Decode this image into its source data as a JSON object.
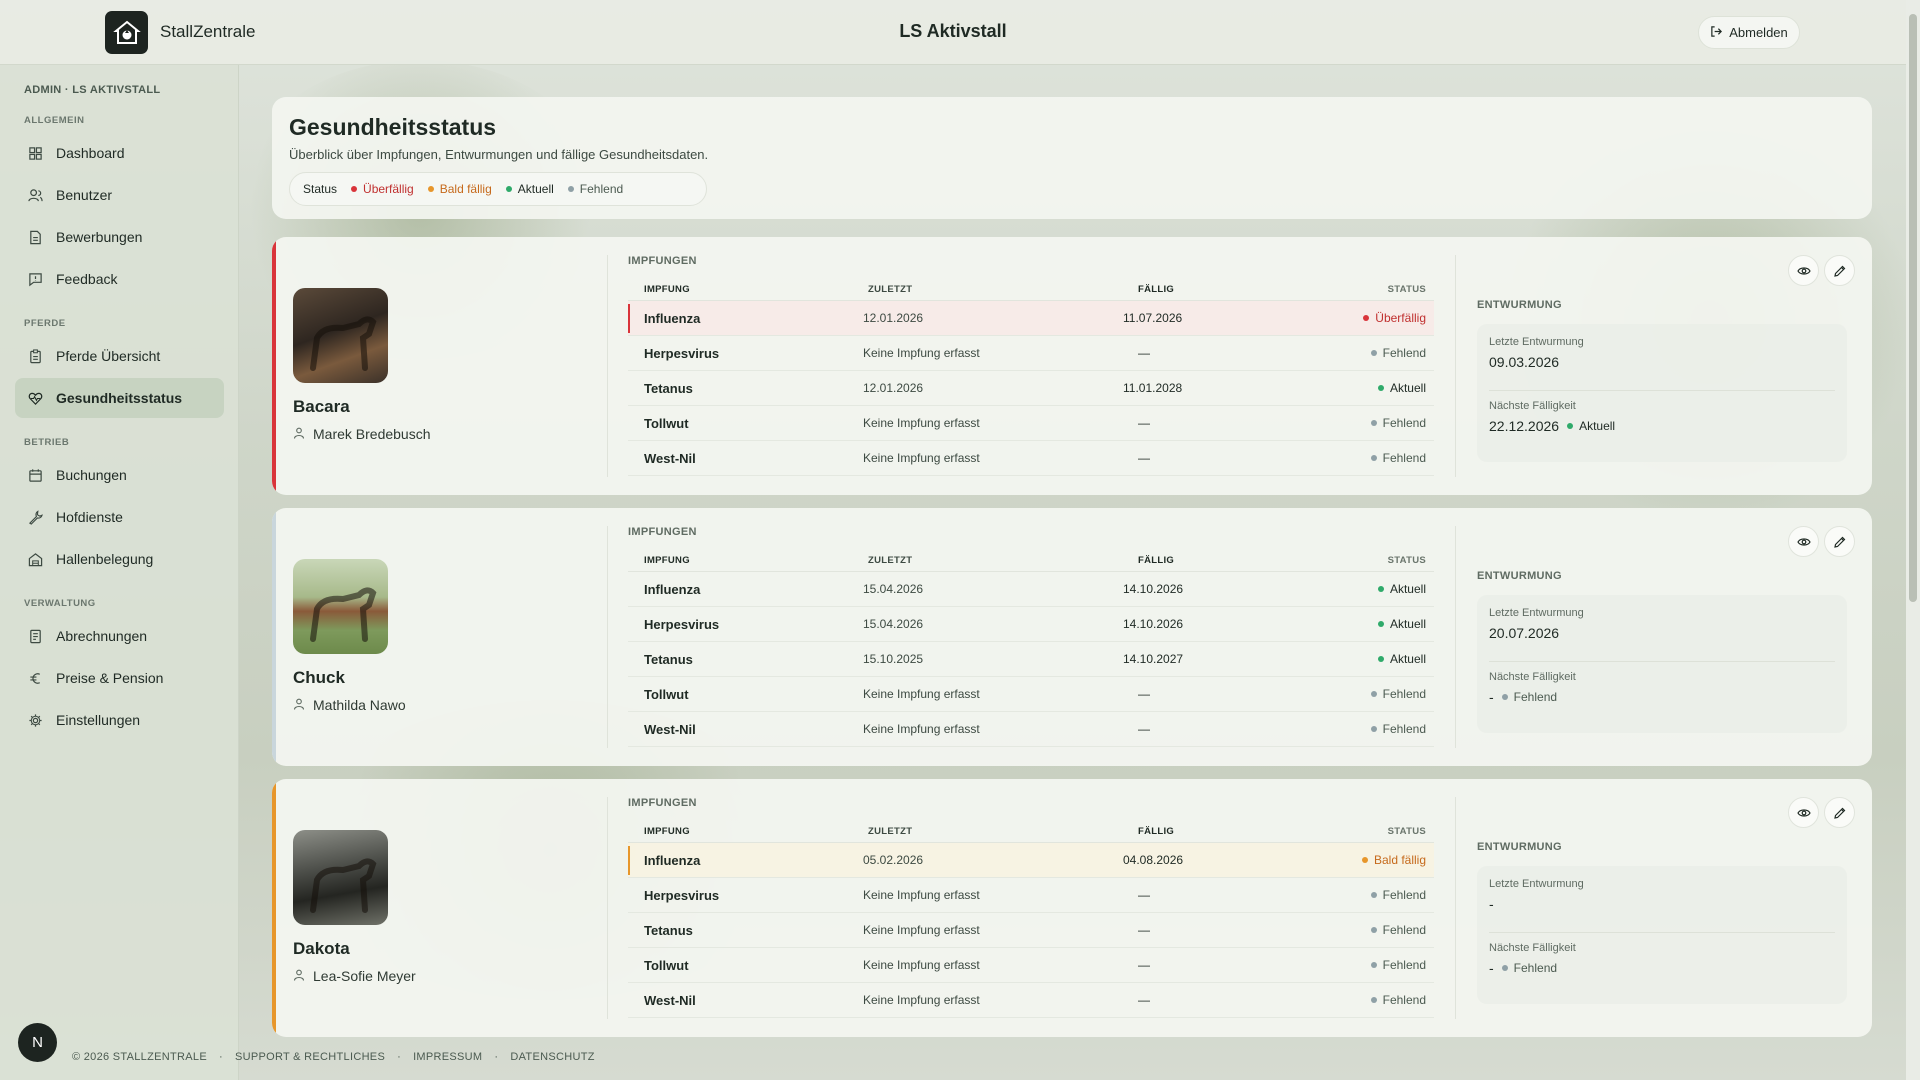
{
  "header": {
    "brand": "StallZentrale",
    "org_title": "LS Aktivstall",
    "logout_label": "Abmelden"
  },
  "sidebar": {
    "admin_label": "ADMIN · LS AKTIVSTALL",
    "sections": {
      "allgemein": "ALLGEMEIN",
      "pferde": "PFERDE",
      "betrieb": "BETRIEB",
      "verwaltung": "VERWALTUNG"
    },
    "items": {
      "dashboard": "Dashboard",
      "benutzer": "Benutzer",
      "bewerbungen": "Bewerbungen",
      "feedback": "Feedback",
      "pferde_uebersicht": "Pferde Übersicht",
      "gesundheitsstatus": "Gesundheitsstatus",
      "buchungen": "Buchungen",
      "hofdienste": "Hofdienste",
      "hallenbelegung": "Hallenbelegung",
      "abrechnungen": "Abrechnungen",
      "preise": "Preise & Pension",
      "einstellungen": "Einstellungen"
    },
    "user_initial": "N"
  },
  "overview": {
    "title": "Gesundheitsstatus",
    "subtitle": "Überblick über Impfungen, Entwurmungen und fällige Gesundheitsdaten.",
    "legend_label": "Status",
    "legend": {
      "overdue": "Überfällig",
      "soon": "Bald fällig",
      "current": "Aktuell",
      "missing": "Fehlend"
    }
  },
  "colors": {
    "overdue": "#d9343a",
    "soon": "#e7962b",
    "current": "#2faa6a",
    "missing": "#8fa0a6",
    "overdue_text": "#c0302f",
    "soon_text": "#c66a1c"
  },
  "table_headers": {
    "section": "IMPFUNGEN",
    "name": "IMPFUNG",
    "last": "ZULETZT",
    "due": "FÄLLIG",
    "status": "STATUS",
    "worm_section": "ENTWURMUNG",
    "worm_last": "Letzte Entwurmung",
    "worm_next": "Nächste Fälligkeit"
  },
  "horses": [
    {
      "name": "Bacara",
      "owner": "Marek Bredebusch",
      "vaccinations": [
        {
          "name": "Influenza",
          "last": "12.01.2026",
          "due": "11.07.2026",
          "status": "Überfällig"
        },
        {
          "name": "Herpesvirus",
          "last": "Keine Impfung erfasst",
          "due": "—",
          "status": "Fehlend"
        },
        {
          "name": "Tetanus",
          "last": "12.01.2026",
          "due": "11.01.2028",
          "status": "Aktuell"
        },
        {
          "name": "Tollwut",
          "last": "Keine Impfung erfasst",
          "due": "—",
          "status": "Fehlend"
        },
        {
          "name": "West-Nil",
          "last": "Keine Impfung erfasst",
          "due": "—",
          "status": "Fehlend"
        }
      ],
      "worming": {
        "last": "09.03.2026",
        "next": "22.12.2026",
        "next_status": "Aktuell"
      }
    },
    {
      "name": "Chuck",
      "owner": "Mathilda Nawo",
      "vaccinations": [
        {
          "name": "Influenza",
          "last": "15.04.2026",
          "due": "14.10.2026",
          "status": "Aktuell"
        },
        {
          "name": "Herpesvirus",
          "last": "15.04.2026",
          "due": "14.10.2026",
          "status": "Aktuell"
        },
        {
          "name": "Tetanus",
          "last": "15.10.2025",
          "due": "14.10.2027",
          "status": "Aktuell"
        },
        {
          "name": "Tollwut",
          "last": "Keine Impfung erfasst",
          "due": "—",
          "status": "Fehlend"
        },
        {
          "name": "West-Nil",
          "last": "Keine Impfung erfasst",
          "due": "—",
          "status": "Fehlend"
        }
      ],
      "worming": {
        "last": "20.07.2026",
        "next": "-",
        "next_status": "Fehlend"
      }
    },
    {
      "name": "Dakota",
      "owner": "Lea-Sofie Meyer",
      "vaccinations": [
        {
          "name": "Influenza",
          "last": "05.02.2026",
          "due": "04.08.2026",
          "status": "Bald fällig"
        },
        {
          "name": "Herpesvirus",
          "last": "Keine Impfung erfasst",
          "due": "—",
          "status": "Fehlend"
        },
        {
          "name": "Tetanus",
          "last": "Keine Impfung erfasst",
          "due": "—",
          "status": "Fehlend"
        },
        {
          "name": "Tollwut",
          "last": "Keine Impfung erfasst",
          "due": "—",
          "status": "Fehlend"
        },
        {
          "name": "West-Nil",
          "last": "Keine Impfung erfasst",
          "due": "—",
          "status": "Fehlend"
        }
      ],
      "worming": {
        "last": "-",
        "next": "-",
        "next_status": "Fehlend"
      }
    }
  ],
  "footer": {
    "copyright": "© 2026 STALLZENTRALE",
    "support": "SUPPORT & RECHTLICHES",
    "impressum": "IMPRESSUM",
    "datenschutz": "DATENSCHUTZ",
    "separator": "·"
  }
}
